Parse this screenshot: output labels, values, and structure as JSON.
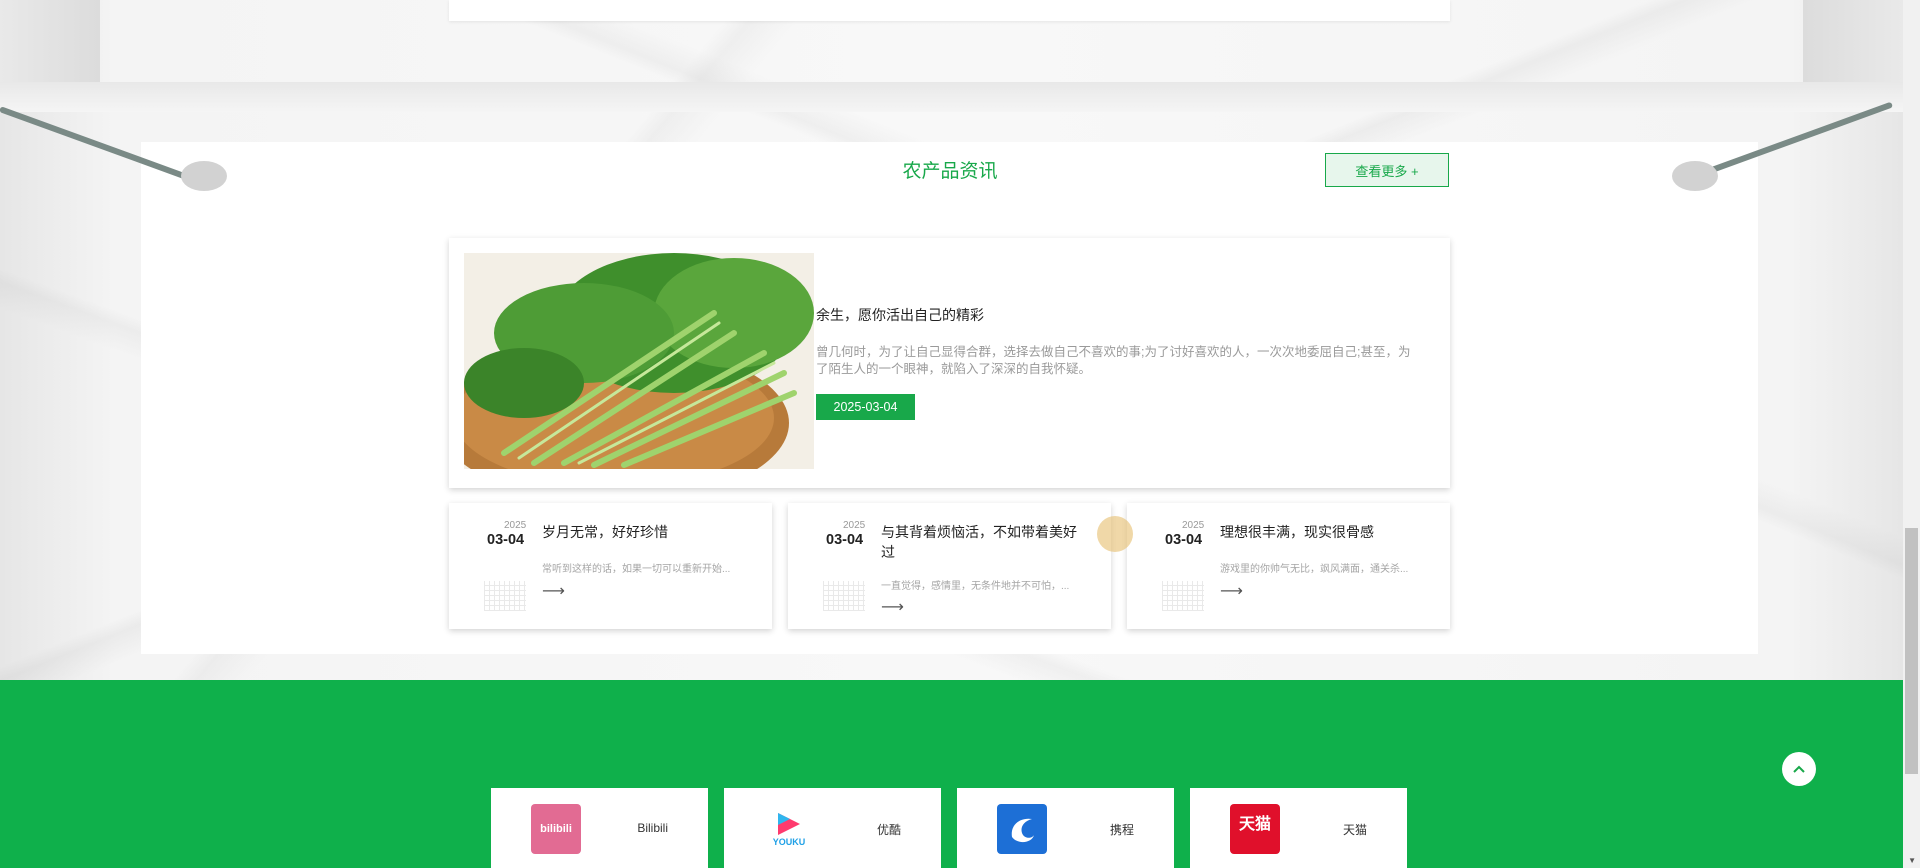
{
  "news": {
    "title": "农产品资讯",
    "more_label": "查看更多 +",
    "featured": {
      "title": "余生，愿你活出自己的精彩",
      "description": "曾几何时，为了让自己显得合群，选择去做自己不喜欢的事;为了讨好喜欢的人，一次次地委屈自己;甚至，为了陌生人的一个眼神，就陷入了深深的自我怀疑。",
      "date": "2025-03-04",
      "image_icon": "spinach-image"
    },
    "items": [
      {
        "year": "2025",
        "day": "03-04",
        "title": "岁月无常，好好珍惜",
        "desc": "常听到这样的话，如果一切可以重新开始..."
      },
      {
        "year": "2025",
        "day": "03-04",
        "title": "与其背着烦恼活，不如带着美好过",
        "desc": "一直觉得，感情里，无条件地并不可怕，..."
      },
      {
        "year": "2025",
        "day": "03-04",
        "title": "理想很丰满，现实很骨感",
        "desc": "游戏里的你帅气无比，飒风满面，通关杀..."
      }
    ],
    "arrow": "⟶"
  },
  "links": [
    {
      "name": "Bilibili",
      "logo_text": "bilibili",
      "color": "#e26b93"
    },
    {
      "name": "优酷",
      "logo_text": "YOUKU",
      "color": "#ffffff"
    },
    {
      "name": "携程",
      "logo_text": "",
      "color": "#1d6fd6"
    },
    {
      "name": "天猫",
      "logo_text": "天猫",
      "color": "#e0102b"
    }
  ],
  "colors": {
    "accent": "#18a84a",
    "footer": "#0fb04b"
  },
  "back_to_top_icon": "chevron-up-icon"
}
